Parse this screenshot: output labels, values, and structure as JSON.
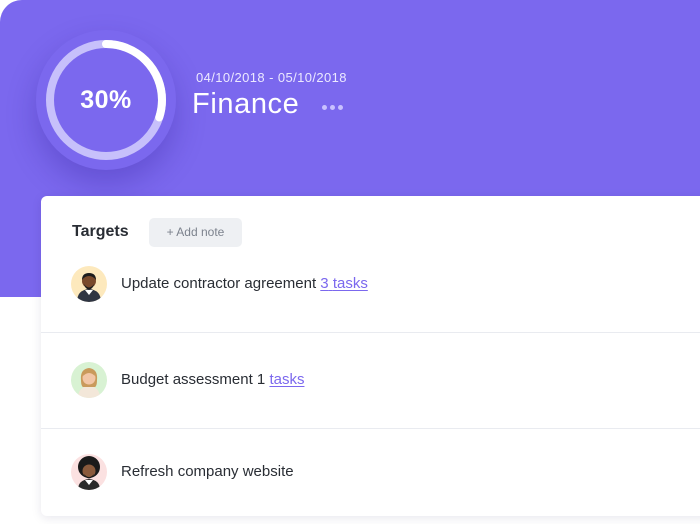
{
  "goal": {
    "progress_label": "30%",
    "progress_fraction": 0.3,
    "date_range": "04/10/2018 - 05/10/2018",
    "title": "Finance"
  },
  "targets": {
    "title": "Targets",
    "add_note_label": "+ Add note",
    "items": [
      {
        "text": "Update contractor agreement",
        "count": "3",
        "link": "tasks"
      },
      {
        "text": "Budget assessment",
        "count": "1",
        "link": "tasks"
      },
      {
        "text": "Refresh company website",
        "count": "",
        "link": ""
      }
    ]
  },
  "colors": {
    "brand": "#7b68ee",
    "ring_track": "#c7c0fb",
    "ring_fill": "#ffffff"
  }
}
